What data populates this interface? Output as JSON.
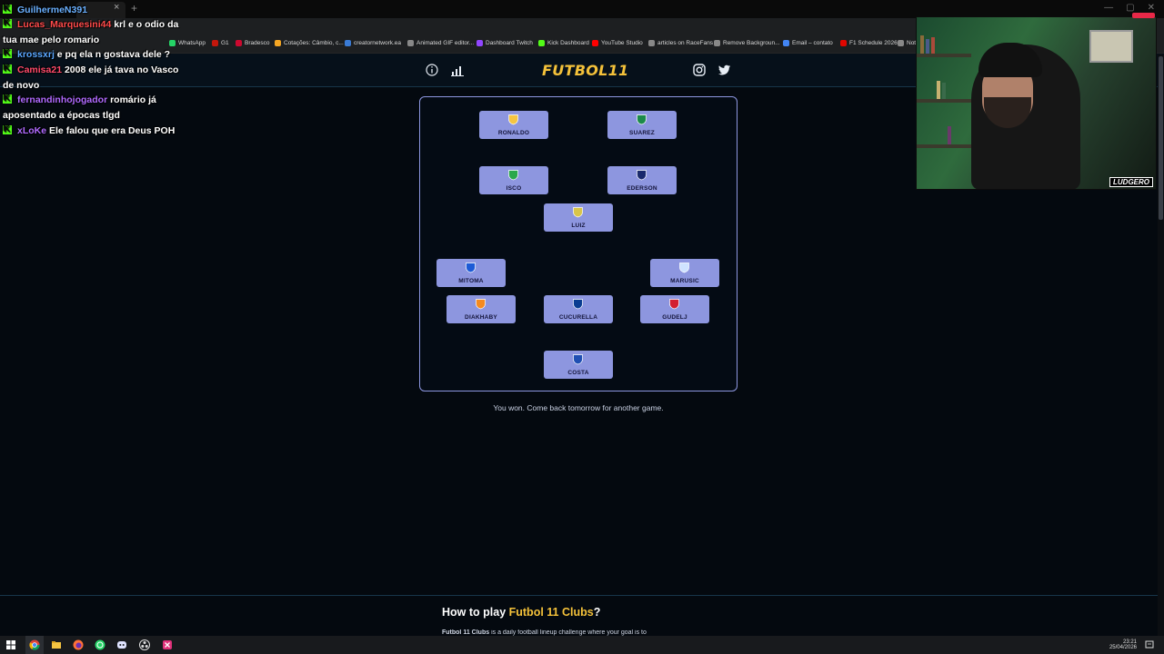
{
  "browser": {
    "bookmarks": [
      {
        "label": "WhatsApp",
        "color": "#25d366"
      },
      {
        "label": "G1",
        "color": "#c4170c"
      },
      {
        "label": "Bradesco",
        "color": "#cc092f"
      },
      {
        "label": "Cotações: Câmbio, c...",
        "color": "#f5a623"
      },
      {
        "label": "creatornetwork.ea",
        "color": "#3a7bd5"
      },
      {
        "label": "Animated GIF editor...",
        "color": "#888888"
      },
      {
        "label": "Dashboard Twitch",
        "color": "#9146ff"
      },
      {
        "label": "Kick Dashboard",
        "color": "#53fc18"
      },
      {
        "label": "YouTube Studio",
        "color": "#ff0000"
      },
      {
        "label": "articles on RaceFans",
        "color": "#888888"
      },
      {
        "label": "Remove Backgroun...",
        "color": "#888888"
      },
      {
        "label": "Email – contato",
        "color": "#4285f4"
      },
      {
        "label": "F1 Schedule 2026",
        "color": "#e10600"
      },
      {
        "label": "Not",
        "color": "#888888"
      }
    ],
    "tab_close": "×",
    "tab_new": "+"
  },
  "site": {
    "logo": "FUTBOL11",
    "header_icons": [
      "info-icon",
      "stats-icon",
      "instagram-icon",
      "twitter-icon"
    ],
    "accent_color": "#f5c23a",
    "card_color": "#8d96df"
  },
  "lineup": {
    "players": [
      {
        "name": "RONALDO",
        "club_icon": "al-nassr-badge",
        "badge_color": "#f5c542"
      },
      {
        "name": "SUAREZ",
        "club_icon": "sporting-badge",
        "badge_color": "#1c8a4a"
      },
      {
        "name": "ISCO",
        "club_icon": "betis-badge",
        "badge_color": "#2aa84a"
      },
      {
        "name": "EDERSON",
        "club_icon": "atalanta-badge",
        "badge_color": "#1a2a6c"
      },
      {
        "name": "LUIZ",
        "club_icon": "aston-villa-badge",
        "badge_color": "#d8c54a"
      },
      {
        "name": "MITOMA",
        "club_icon": "brighton-badge",
        "badge_color": "#1d5bd6"
      },
      {
        "name": "MARUSIC",
        "club_icon": "lazio-badge",
        "badge_color": "#cfe3ff"
      },
      {
        "name": "DIAKHABY",
        "club_icon": "valencia-badge",
        "badge_color": "#f58a1f"
      },
      {
        "name": "CUCURELLA",
        "club_icon": "chelsea-badge",
        "badge_color": "#0a3d91"
      },
      {
        "name": "GUDELJ",
        "club_icon": "sevilla-badge",
        "badge_color": "#d31f2f"
      },
      {
        "name": "COSTA",
        "club_icon": "porto-badge",
        "badge_color": "#1f4fb3"
      }
    ]
  },
  "status": {
    "message": "You won. Come back tomorrow for another game."
  },
  "howto": {
    "title_prefix": "How to play ",
    "title_highlight": "Futbol 11 Clubs",
    "title_suffix": "?",
    "desc_bold": "Futbol 11 Clubs",
    "desc": " is a daily football lineup challenge where your goal is to"
  },
  "chat": [
    {
      "user": "GuilhermeN391",
      "color": "#6ab0ff",
      "msg": ""
    },
    {
      "user": "Lucas_Marquesini44",
      "color": "#ff4a4a",
      "msg": "krl e o odio da"
    },
    {
      "user": "",
      "color": "#ffffff",
      "msg": "tua mae pelo romario"
    },
    {
      "user": "krossxrj",
      "color": "#5aa7ff",
      "msg": "e pq ela n gostava dele ?"
    },
    {
      "user": "Camisa21",
      "color": "#ff4a6a",
      "msg": "2008 ele já tava no Vasco"
    },
    {
      "user": "",
      "color": "#ffffff",
      "msg": "de novo"
    },
    {
      "user": "fernandinhojogador",
      "color": "#b06aff",
      "msg": "romário já"
    },
    {
      "user": "",
      "color": "#ffffff",
      "msg": "aposentado a épocas tlgd"
    },
    {
      "user": "xLoKe",
      "color": "#b06aff",
      "msg": "Ele falou que era Deus POH"
    }
  ],
  "webcam": {
    "tag": "LUDGERO"
  },
  "taskbar": {
    "time": "23:21",
    "date": "25/04/2026"
  }
}
